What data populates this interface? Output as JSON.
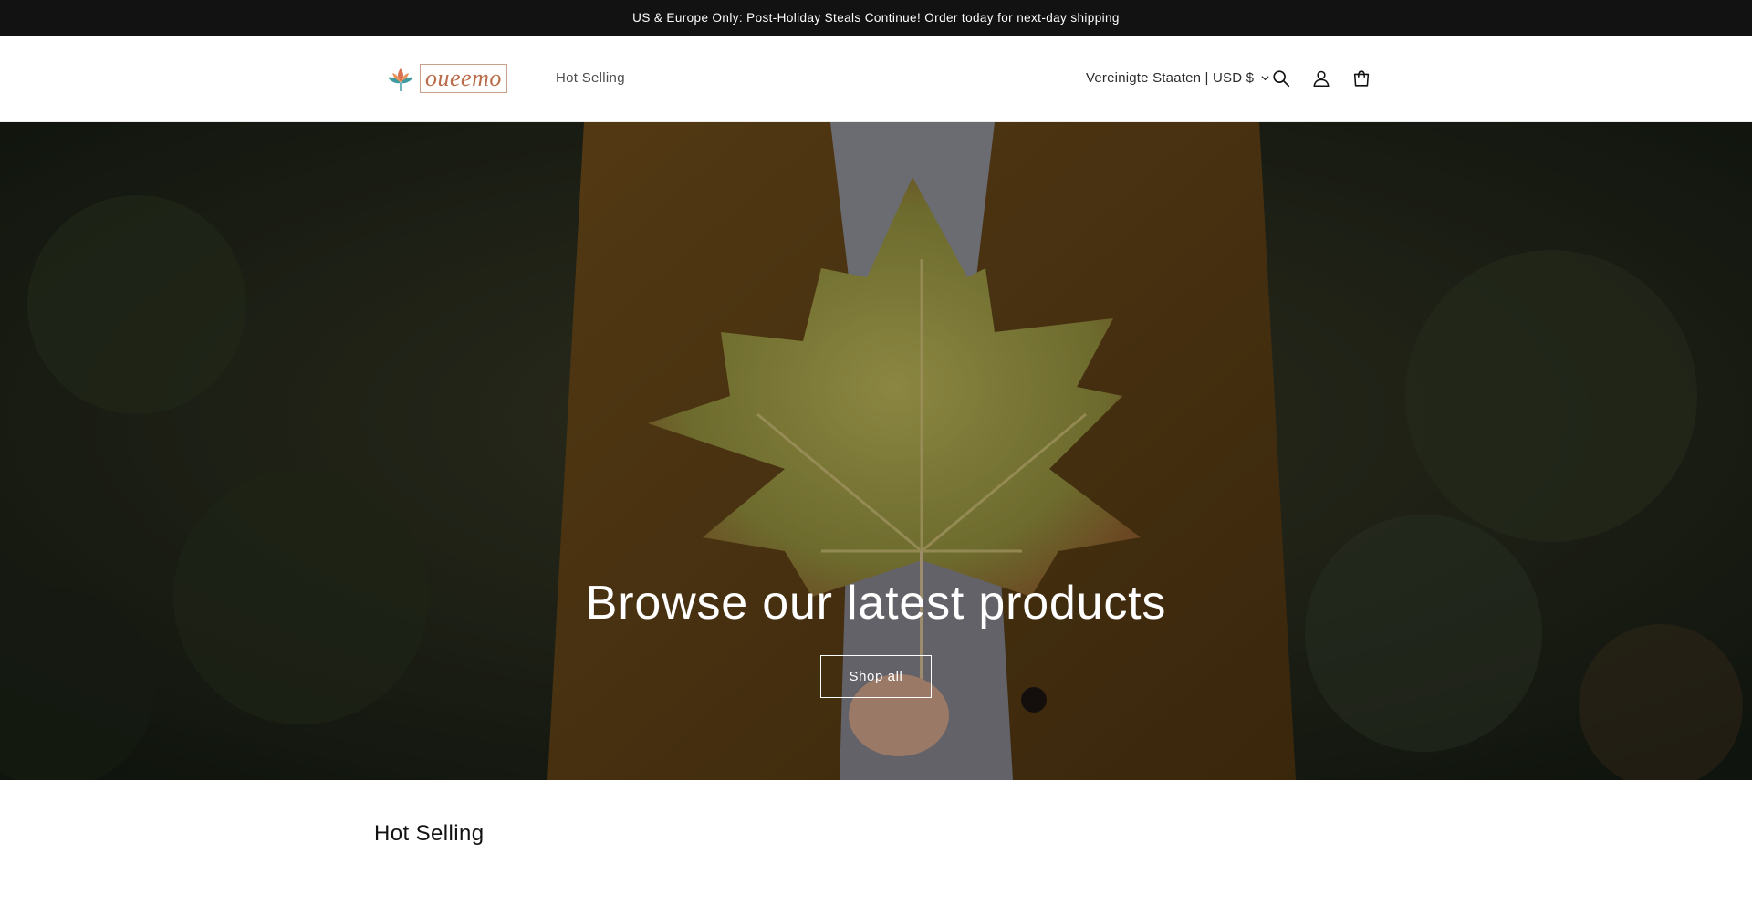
{
  "announcement": {
    "text": "US & Europe Only: Post-Holiday Steals Continue! Order today for next-day shipping"
  },
  "header": {
    "logo_text": "oueemo",
    "nav": [
      {
        "label": "Hot Selling"
      }
    ],
    "locale_label": "Vereinigte Staaten | USD $",
    "icons": [
      "search-icon",
      "account-icon",
      "cart-icon"
    ]
  },
  "hero": {
    "title": "Browse our latest products",
    "button_label": "Shop all"
  },
  "section": {
    "title": "Hot Selling"
  },
  "colors": {
    "announcement_bg": "#121212",
    "logo_accent": "#b96b4a",
    "hero_text": "#ffffff"
  }
}
